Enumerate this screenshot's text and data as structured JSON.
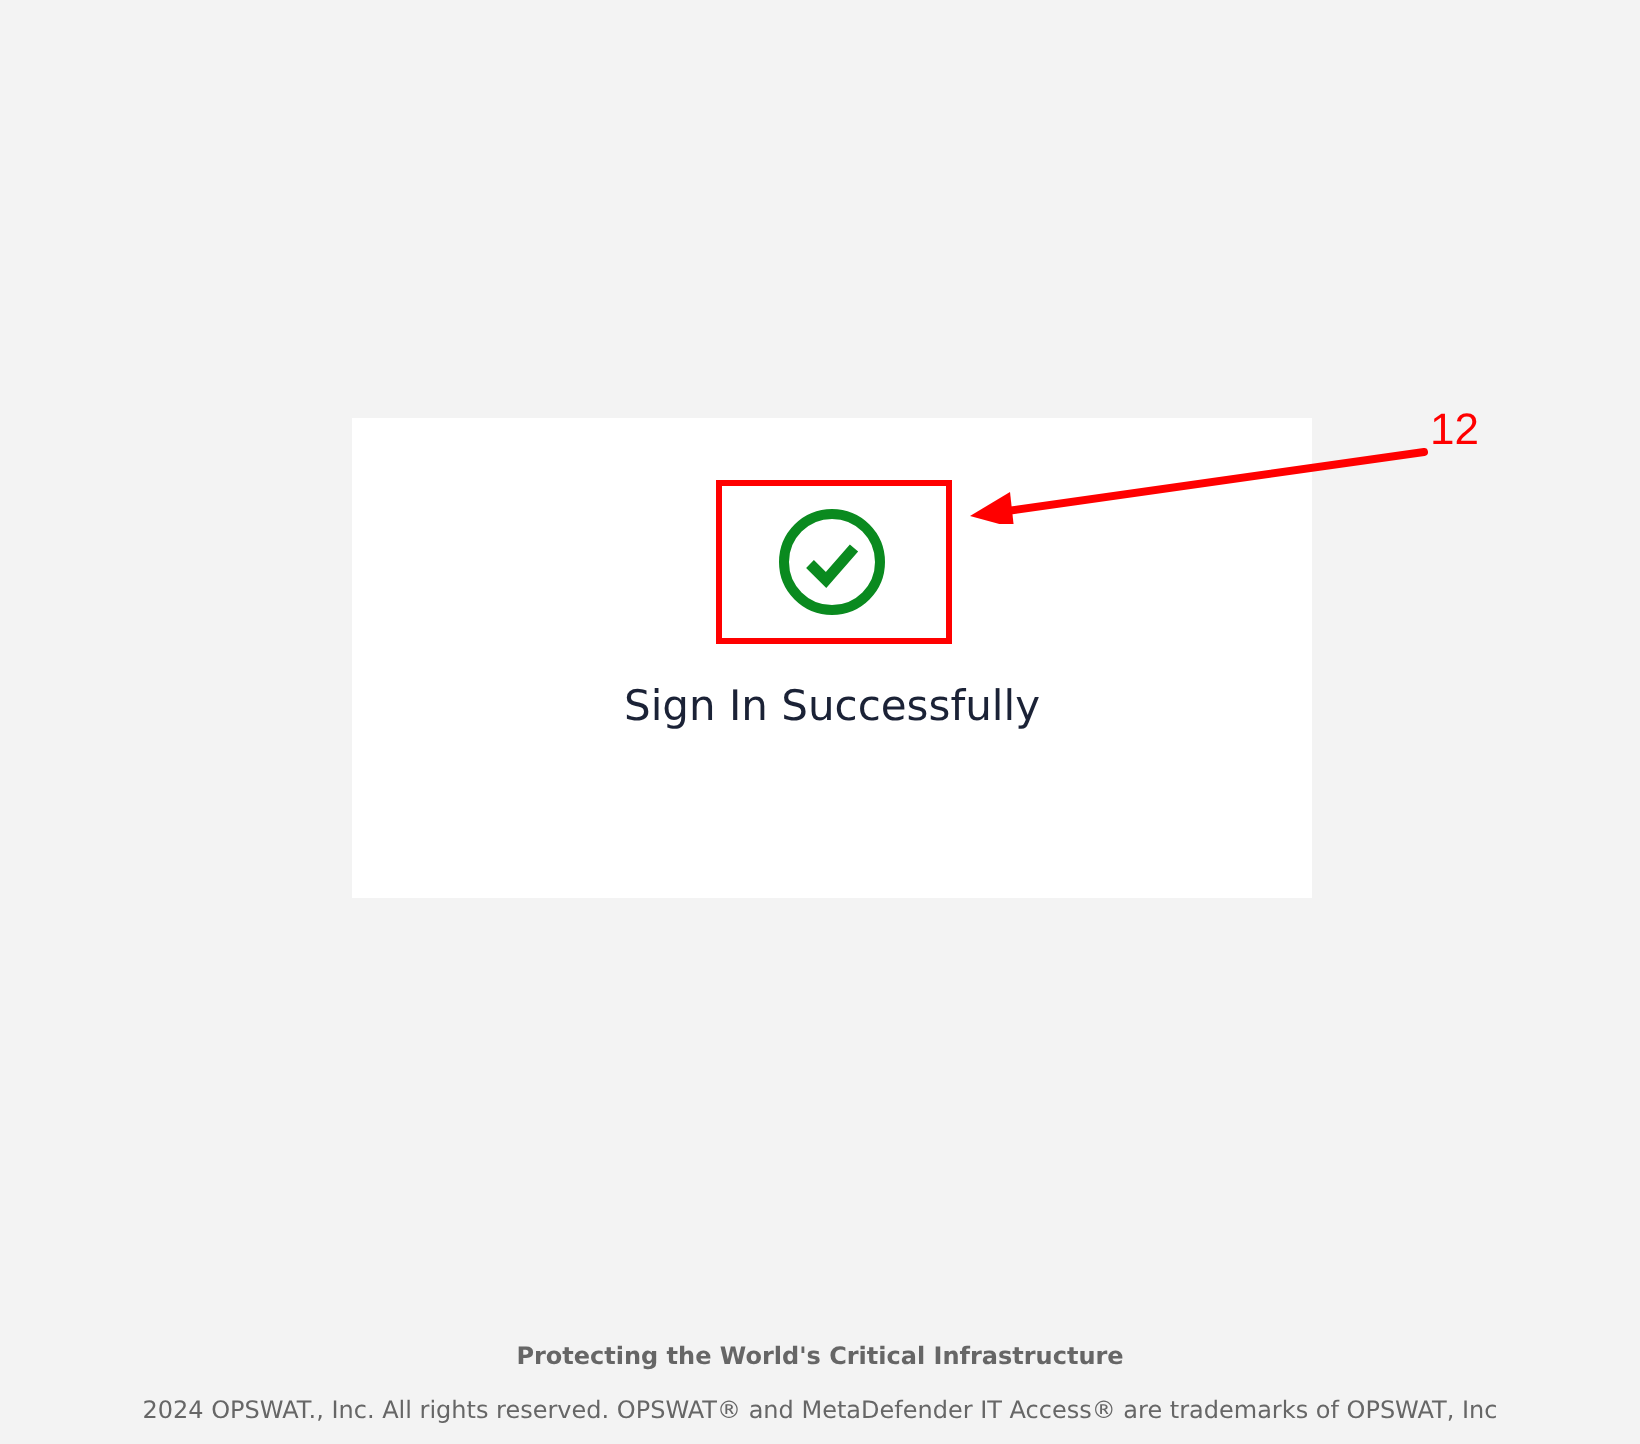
{
  "card": {
    "succeeded": true,
    "message": "Sign In Successfully"
  },
  "annotation": {
    "label": "12"
  },
  "footer": {
    "tagline": "Protecting the World's Critical Infrastructure",
    "copyright": "2024 OPSWAT., Inc. All rights reserved. OPSWAT® and MetaDefender IT Access® are trademarks of OPSWAT, Inc"
  }
}
